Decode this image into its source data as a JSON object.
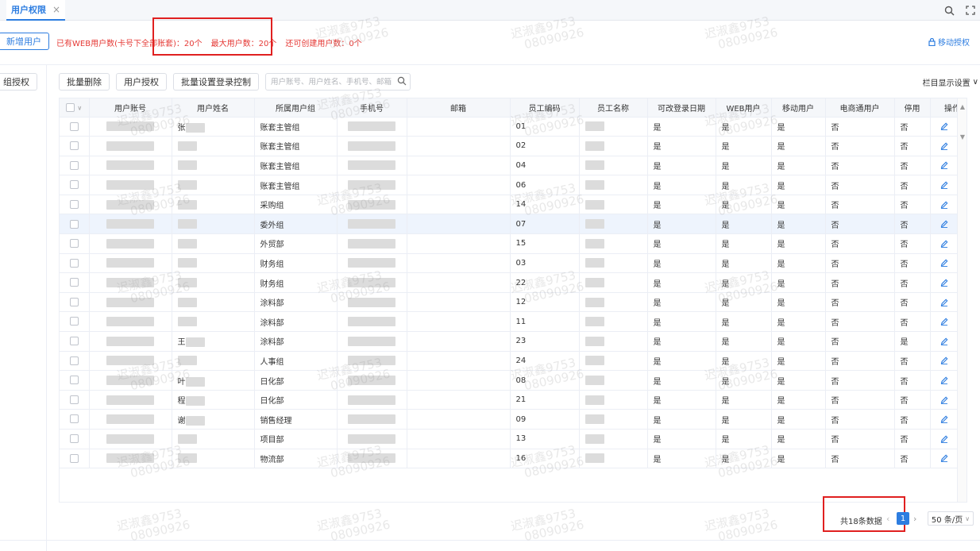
{
  "tab": {
    "title": "用户权限",
    "close": "×"
  },
  "header": {
    "new_user": "新增用户",
    "stats": [
      "已有WEB用户数(卡号下全部账套)：20个",
      "最大用户数：20个",
      "还可创建用户数：0个"
    ],
    "mobile_auth": "移动授权"
  },
  "sidebar": {
    "group_auth": "组授权"
  },
  "toolbar": {
    "batch_delete": "批量删除",
    "user_auth": "用户授权",
    "batch_login": "批量设置登录控制",
    "search_placeholder": "用户账号、用户姓名、手机号、邮箱"
  },
  "column_settings": "栏目显示设置",
  "table": {
    "headers": [
      "",
      "用户账号",
      "用户姓名",
      "所属用户组",
      "手机号",
      "邮箱",
      "员工编码",
      "员工名称",
      "可改登录日期",
      "WEB用户",
      "移动用户",
      "电商通用户",
      "停用",
      "操作"
    ],
    "rows": [
      {
        "name": "张",
        "group": "账套主管组",
        "code": "01",
        "date": "是",
        "web": "是",
        "mobile": "是",
        "ecom": "否",
        "disabled": "否"
      },
      {
        "name": "",
        "group": "账套主管组",
        "code": "02",
        "date": "是",
        "web": "是",
        "mobile": "是",
        "ecom": "否",
        "disabled": "否"
      },
      {
        "name": "",
        "group": "账套主管组",
        "code": "04",
        "date": "是",
        "web": "是",
        "mobile": "是",
        "ecom": "否",
        "disabled": "否"
      },
      {
        "name": "",
        "group": "账套主管组",
        "code": "06",
        "date": "是",
        "web": "是",
        "mobile": "是",
        "ecom": "否",
        "disabled": "否"
      },
      {
        "name": "",
        "group": "采购组",
        "code": "14",
        "date": "是",
        "web": "是",
        "mobile": "是",
        "ecom": "否",
        "disabled": "否"
      },
      {
        "name": "",
        "group": "委外组",
        "code": "07",
        "date": "是",
        "web": "是",
        "mobile": "是",
        "ecom": "否",
        "disabled": "否"
      },
      {
        "name": "",
        "group": "外贸部",
        "code": "15",
        "date": "是",
        "web": "是",
        "mobile": "是",
        "ecom": "否",
        "disabled": "否"
      },
      {
        "name": "",
        "group": "财务组",
        "code": "03",
        "date": "是",
        "web": "是",
        "mobile": "是",
        "ecom": "否",
        "disabled": "否"
      },
      {
        "name": "",
        "group": "财务组",
        "code": "22",
        "date": "是",
        "web": "是",
        "mobile": "是",
        "ecom": "否",
        "disabled": "否"
      },
      {
        "name": "",
        "group": "涂料部",
        "code": "12",
        "date": "是",
        "web": "是",
        "mobile": "是",
        "ecom": "否",
        "disabled": "否"
      },
      {
        "name": "",
        "group": "涂料部",
        "code": "11",
        "date": "是",
        "web": "是",
        "mobile": "是",
        "ecom": "否",
        "disabled": "否"
      },
      {
        "name": "王",
        "group": "涂料部",
        "code": "23",
        "date": "是",
        "web": "是",
        "mobile": "是",
        "ecom": "否",
        "disabled": "是"
      },
      {
        "name": "",
        "group": "人事组",
        "code": "24",
        "date": "是",
        "web": "是",
        "mobile": "是",
        "ecom": "否",
        "disabled": "否"
      },
      {
        "name": "叶",
        "group": "日化部",
        "code": "08",
        "date": "是",
        "web": "是",
        "mobile": "是",
        "ecom": "否",
        "disabled": "否"
      },
      {
        "name": "程",
        "group": "日化部",
        "code": "21",
        "date": "是",
        "web": "是",
        "mobile": "是",
        "ecom": "否",
        "disabled": "否"
      },
      {
        "name": "谢",
        "group": "销售经理",
        "code": "09",
        "date": "是",
        "web": "是",
        "mobile": "是",
        "ecom": "否",
        "disabled": "否"
      },
      {
        "name": "",
        "group": "项目部",
        "code": "13",
        "date": "是",
        "web": "是",
        "mobile": "是",
        "ecom": "否",
        "disabled": "否"
      },
      {
        "name": "",
        "group": "物流部",
        "code": "16",
        "date": "是",
        "web": "是",
        "mobile": "是",
        "ecom": "否",
        "disabled": "否"
      }
    ]
  },
  "pager": {
    "total": "共18条数据",
    "page": "1",
    "size": "50 条/页"
  },
  "watermark": [
    "迟淑鑫9753",
    "08090926"
  ],
  "colors": {
    "accent": "#2d7de0",
    "alert": "#e53935",
    "box": "#e02020"
  }
}
